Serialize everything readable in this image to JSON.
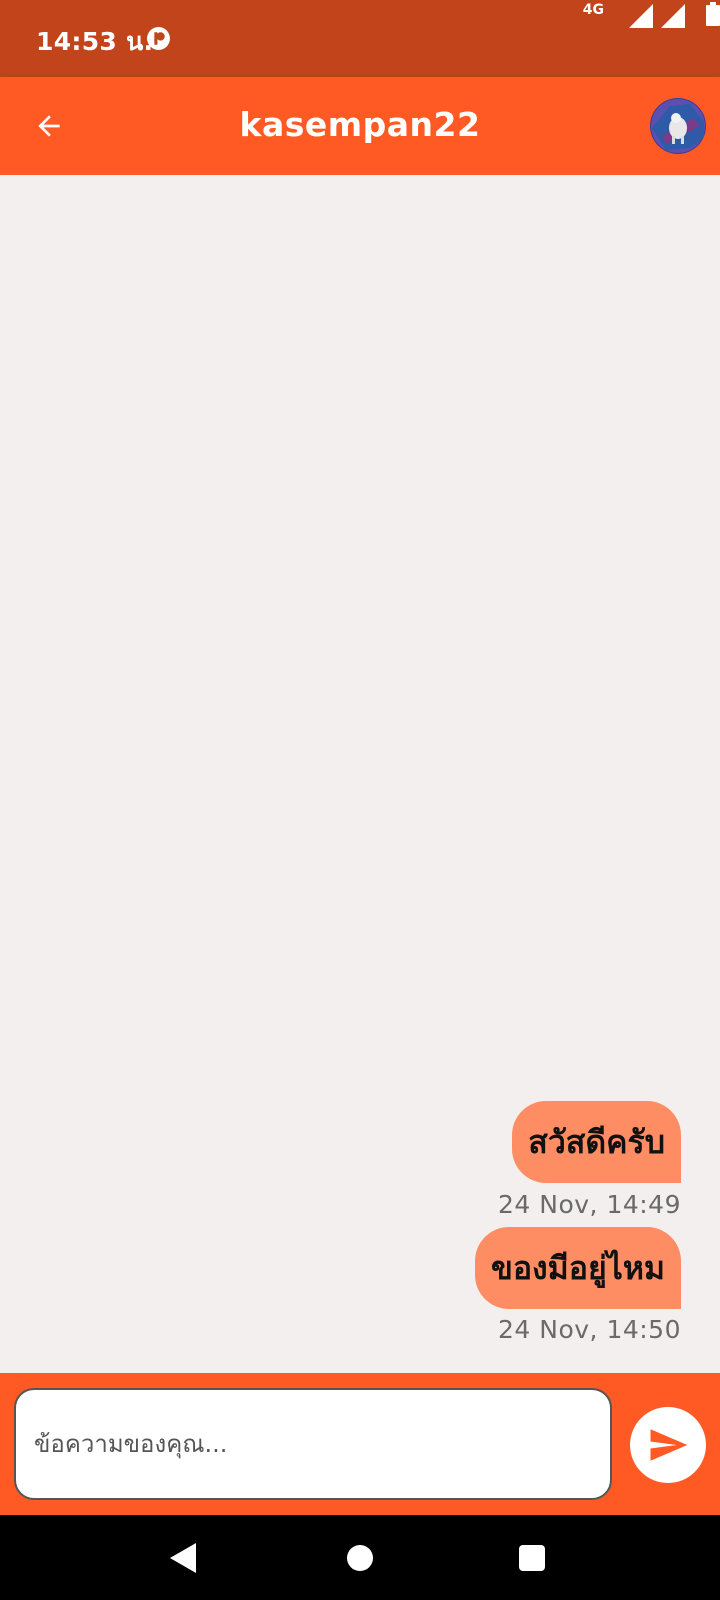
{
  "status_bar": {
    "time": "14:53 น.",
    "network": "4G"
  },
  "header": {
    "title": "kasempan22"
  },
  "messages": [
    {
      "text": "สวัสดีครับ",
      "timestamp": "24 Nov, 14:49"
    },
    {
      "text": "ของมีอยู่ไหม",
      "timestamp": "24 Nov, 14:50"
    }
  ],
  "composer": {
    "placeholder": "ข้อความของคุณ..."
  },
  "colors": {
    "status_bar": "#c1441b",
    "accent": "#ff5a24",
    "bubble": "#ff8d64",
    "background": "#f2efee"
  },
  "icons": {
    "back": "arrow-left-icon",
    "send": "send-icon",
    "nav_back": "triangle-back-icon",
    "nav_home": "circle-home-icon",
    "nav_recent": "square-recents-icon"
  }
}
